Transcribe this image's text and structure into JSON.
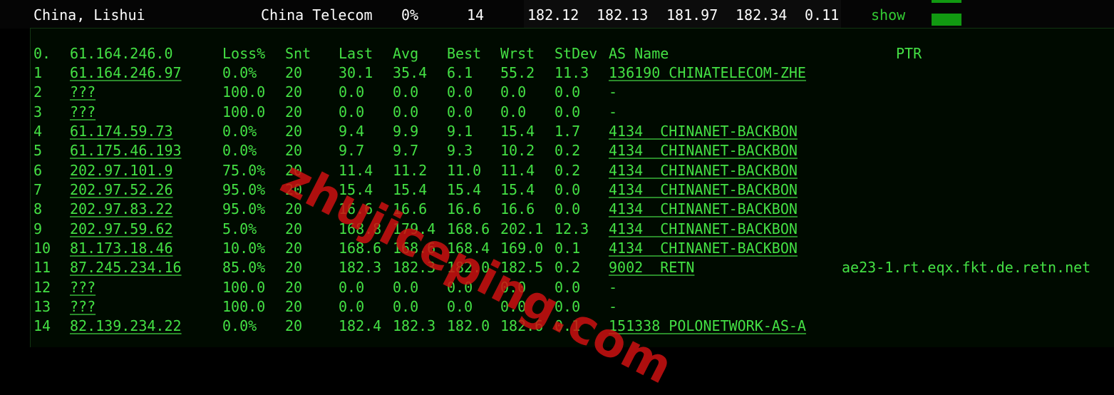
{
  "summary": {
    "location": "China, Lishui",
    "isp": "China Telecom",
    "loss": "0%",
    "hops": "14",
    "last": "182.12",
    "avg": "182.13",
    "best": "181.97",
    "worst": "182.34",
    "stdev": "0.11",
    "show_label": "show"
  },
  "headers": [
    "0.",
    "61.164.246.0",
    "Loss%",
    "Snt",
    "Last",
    "Avg",
    "Best",
    "Wrst",
    "StDev",
    "AS Name",
    "PTR"
  ],
  "hops": [
    [
      "1",
      "61.164.246.97",
      "0.0%",
      "20",
      "30.1",
      "35.4",
      "6.1",
      "55.2",
      "11.3",
      "136190 CHINATELECOM-ZHE",
      ""
    ],
    [
      "2",
      "???",
      "100.0",
      "20",
      "0.0",
      "0.0",
      "0.0",
      "0.0",
      "0.0",
      "-",
      ""
    ],
    [
      "3",
      "???",
      "100.0",
      "20",
      "0.0",
      "0.0",
      "0.0",
      "0.0",
      "0.0",
      "-",
      ""
    ],
    [
      "4",
      "61.174.59.73",
      "0.0%",
      "20",
      "9.4",
      "9.9",
      "9.1",
      "15.4",
      "1.7",
      "4134  CHINANET-BACKBON",
      ""
    ],
    [
      "5",
      "61.175.46.193",
      "0.0%",
      "20",
      "9.7",
      "9.7",
      "9.3",
      "10.2",
      "0.2",
      "4134  CHINANET-BACKBON",
      ""
    ],
    [
      "6",
      "202.97.101.9",
      "75.0%",
      "20",
      "11.4",
      "11.2",
      "11.0",
      "11.4",
      "0.2",
      "4134  CHINANET-BACKBON",
      ""
    ],
    [
      "7",
      "202.97.52.26",
      "95.0%",
      "20",
      "15.4",
      "15.4",
      "15.4",
      "15.4",
      "0.0",
      "4134  CHINANET-BACKBON",
      ""
    ],
    [
      "8",
      "202.97.83.22",
      "95.0%",
      "20",
      "16.6",
      "16.6",
      "16.6",
      "16.6",
      "0.0",
      "4134  CHINANET-BACKBON",
      ""
    ],
    [
      "9",
      "202.97.59.62",
      "5.0%",
      "20",
      "168.8",
      "179.4",
      "168.6",
      "202.1",
      "12.3",
      "4134  CHINANET-BACKBON",
      ""
    ],
    [
      "10",
      "81.173.18.46",
      "10.0%",
      "20",
      "168.6",
      "168.6",
      "168.4",
      "169.0",
      "0.1",
      "4134  CHINANET-BACKBON",
      ""
    ],
    [
      "11",
      "87.245.234.16",
      "85.0%",
      "20",
      "182.3",
      "182.3",
      "182.0",
      "182.5",
      "0.2",
      "9002  RETN",
      "ae23-1.rt.eqx.fkt.de.retn.net"
    ],
    [
      "12",
      "???",
      "100.0",
      "20",
      "0.0",
      "0.0",
      "0.0",
      "0.0",
      "0.0",
      "-",
      ""
    ],
    [
      "13",
      "???",
      "100.0",
      "20",
      "0.0",
      "0.0",
      "0.0",
      "0.0",
      "0.0",
      "-",
      ""
    ],
    [
      "14",
      "82.139.234.22",
      "0.0%",
      "20",
      "182.4",
      "182.3",
      "182.0",
      "182.6",
      "0.1",
      "151338 POLONETWORK-AS-A",
      ""
    ]
  ],
  "watermark": "zhujiceping.com",
  "colors": {
    "text": "#44e044",
    "background": "#000a00",
    "bar": "#119911",
    "watermark": "#cc1111"
  }
}
